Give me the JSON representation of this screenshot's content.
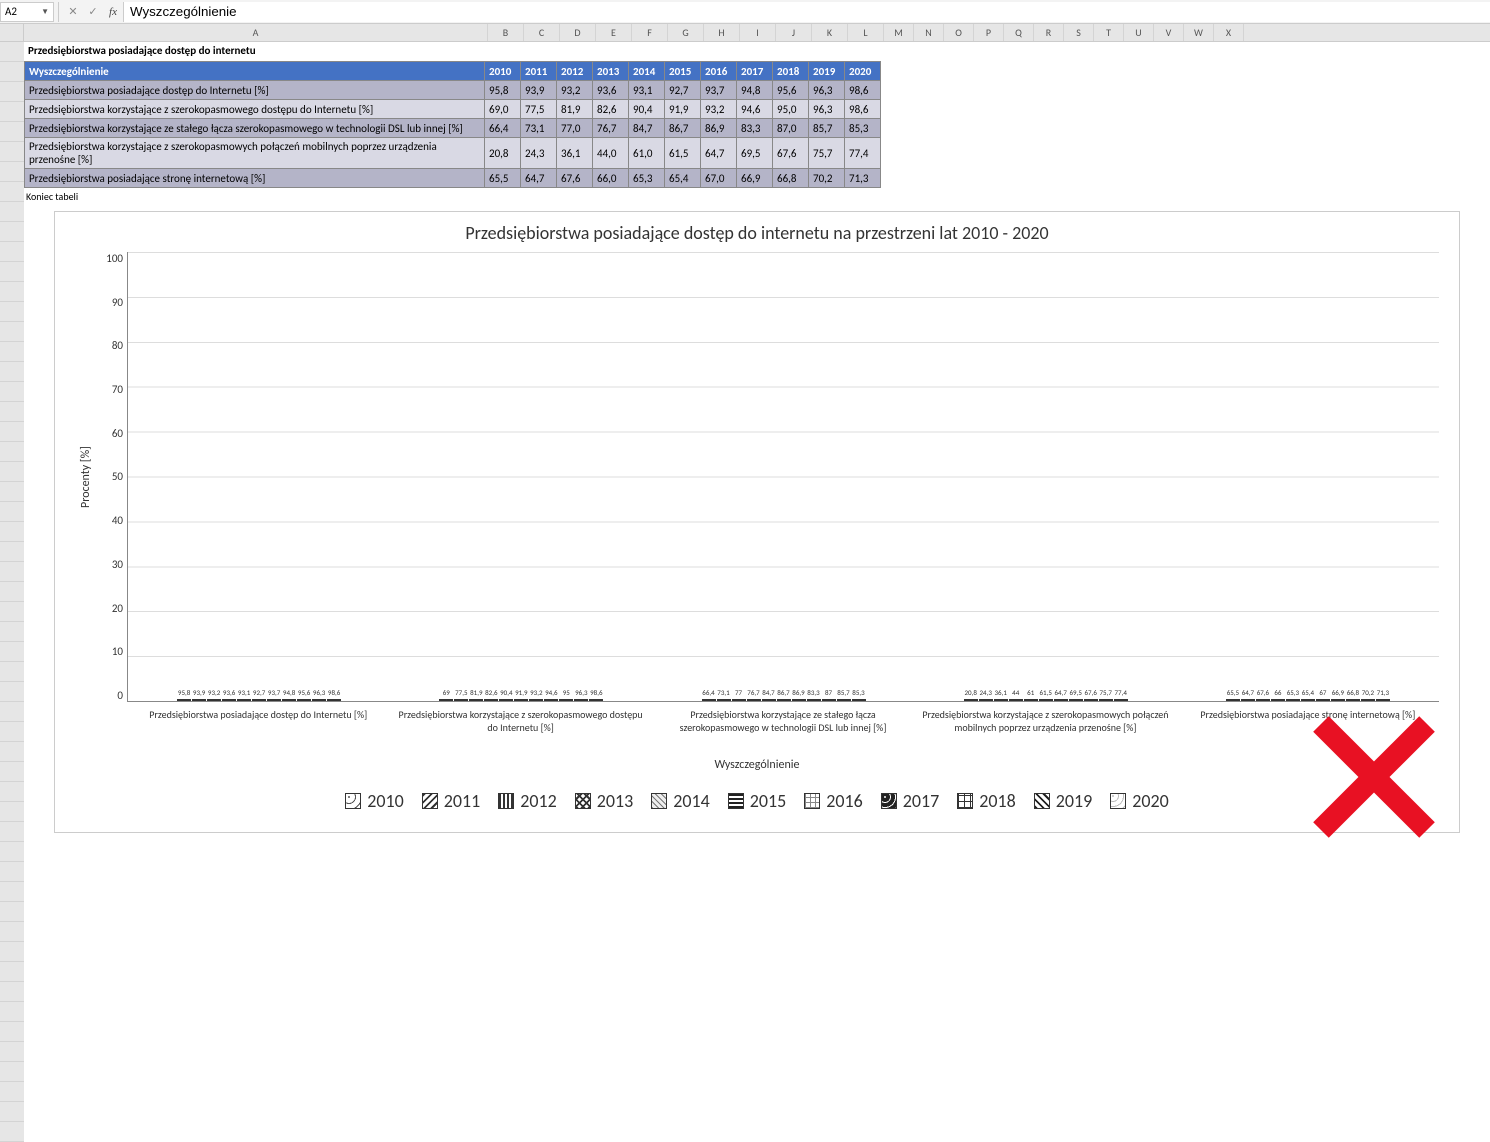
{
  "formula_bar": {
    "cell_ref": "A2",
    "formula": "Wyszczególnienie"
  },
  "col_letters": [
    "A",
    "B",
    "C",
    "D",
    "E",
    "F",
    "G",
    "H",
    "I",
    "J",
    "K",
    "L",
    "M",
    "N",
    "O",
    "P",
    "Q",
    "R",
    "S",
    "T",
    "U",
    "V",
    "W",
    "X"
  ],
  "table": {
    "title": "Przedsiębiorstwa posiadające dostęp do internetu",
    "header_first": "Wyszczególnienie",
    "years": [
      "2010",
      "2011",
      "2012",
      "2013",
      "2014",
      "2015",
      "2016",
      "2017",
      "2018",
      "2019",
      "2020"
    ],
    "rows": [
      {
        "label": "Przedsiębiorstwa posiadające dostęp do Internetu [%]",
        "vals": [
          "95,8",
          "93,9",
          "93,2",
          "93,6",
          "93,1",
          "92,7",
          "93,7",
          "94,8",
          "95,6",
          "96,3",
          "98,6"
        ]
      },
      {
        "label": "Przedsiębiorstwa korzystające z szerokopasmowego dostępu do Internetu [%]",
        "vals": [
          "69,0",
          "77,5",
          "81,9",
          "82,6",
          "90,4",
          "91,9",
          "93,2",
          "94,6",
          "95,0",
          "96,3",
          "98,6"
        ]
      },
      {
        "label": "Przedsiębiorstwa korzystające ze stałego łącza szerokopasmowego w technologii DSL lub innej [%]",
        "vals": [
          "66,4",
          "73,1",
          "77,0",
          "76,7",
          "84,7",
          "86,7",
          "86,9",
          "83,3",
          "87,0",
          "85,7",
          "85,3"
        ]
      },
      {
        "label": "Przedsiębiorstwa korzystające z szerokopasmowych połączeń mobilnych poprzez urządzenia przenośne [%]",
        "vals": [
          "20,8",
          "24,3",
          "36,1",
          "44,0",
          "61,0",
          "61,5",
          "64,7",
          "69,5",
          "67,6",
          "75,7",
          "77,4"
        ]
      },
      {
        "label": "Przedsiębiorstwa posiadające stronę internetową [%]",
        "vals": [
          "65,5",
          "64,7",
          "67,6",
          "66,0",
          "65,3",
          "65,4",
          "67,0",
          "66,9",
          "66,8",
          "70,2",
          "71,3"
        ]
      }
    ],
    "end_label": "Koniec tabeli"
  },
  "chart_data": {
    "type": "bar",
    "title": "Przedsiębiorstwa posiadające dostęp do internetu na przestrzeni lat 2010 - 2020",
    "ylabel": "Procenty [%]",
    "xlabel": "Wyszczególnienie",
    "ylim": [
      0,
      100
    ],
    "yticks": [
      0,
      10,
      20,
      30,
      40,
      50,
      60,
      70,
      80,
      90,
      100
    ],
    "categories": [
      "Przedsiębiorstwa posiadające dostęp do Internetu [%]",
      "Przedsiębiorstwa korzystające z szerokopasmowego dostępu do Internetu [%]",
      "Przedsiębiorstwa korzystające ze stałego łącza szerokopasmowego w technologii DSL lub innej [%]",
      "Przedsiębiorstwa korzystające z szerokopasmowych połączeń mobilnych poprzez urządzenia przenośne [%]",
      "Przedsiębiorstwa posiadające stronę internetową [%]"
    ],
    "series": [
      {
        "name": "2010",
        "values": [
          95.8,
          69.0,
          66.4,
          20.8,
          65.5
        ]
      },
      {
        "name": "2011",
        "values": [
          93.9,
          77.5,
          73.1,
          24.3,
          64.7
        ]
      },
      {
        "name": "2012",
        "values": [
          93.2,
          81.9,
          77.0,
          36.1,
          67.6
        ]
      },
      {
        "name": "2013",
        "values": [
          93.6,
          82.6,
          76.7,
          44.0,
          66.0
        ]
      },
      {
        "name": "2014",
        "values": [
          93.1,
          90.4,
          84.7,
          61.0,
          65.3
        ]
      },
      {
        "name": "2015",
        "values": [
          92.7,
          91.9,
          86.7,
          61.5,
          65.4
        ]
      },
      {
        "name": "2016",
        "values": [
          93.7,
          93.2,
          86.9,
          64.7,
          67.0
        ]
      },
      {
        "name": "2017",
        "values": [
          94.8,
          94.6,
          83.3,
          69.5,
          66.9
        ]
      },
      {
        "name": "2018",
        "values": [
          95.6,
          95.0,
          87.0,
          67.6,
          66.8
        ]
      },
      {
        "name": "2019",
        "values": [
          96.3,
          96.3,
          85.7,
          75.7,
          70.2
        ]
      },
      {
        "name": "2020",
        "values": [
          98.6,
          98.6,
          85.3,
          77.4,
          71.3
        ]
      }
    ]
  }
}
